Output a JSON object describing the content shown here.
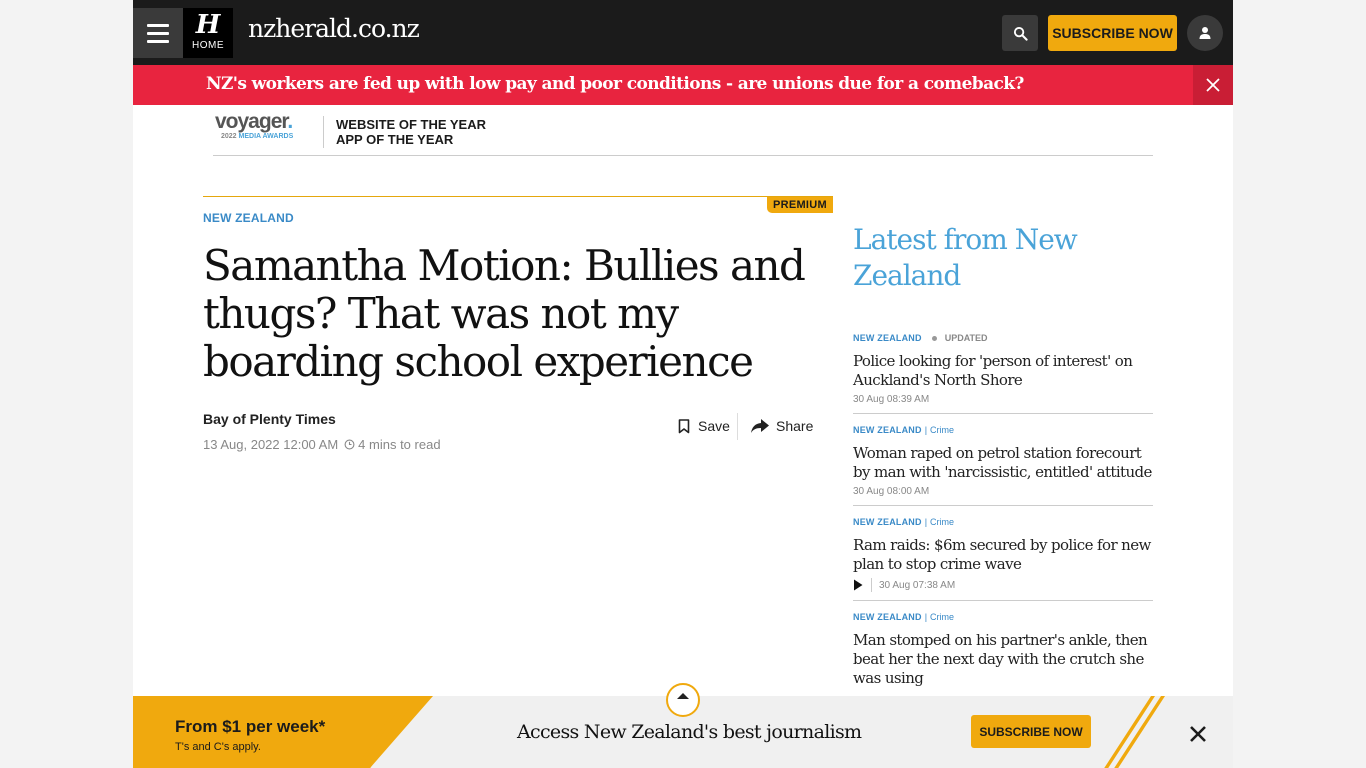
{
  "header": {
    "home_logo_letter": "H",
    "home_label": "HOME",
    "site_name": "nzherald.co.nz",
    "subscribe_label": "SUBSCRIBE NOW"
  },
  "breaking": {
    "text": "NZ's workers are fed up with low pay and poor conditions - are unions due for a comeback?"
  },
  "awards": {
    "brand": "voyager",
    "sub_year": "2022",
    "sub_label": "MEDIA AWARDS",
    "line1": "WEBSITE OF THE YEAR",
    "line2": "APP OF THE YEAR"
  },
  "article": {
    "badge": "PREMIUM",
    "section": "NEW ZEALAND",
    "headline": "Samantha Motion: Bullies and thugs? That was not my boarding school experience",
    "source": "Bay of Plenty Times",
    "date": "13 Aug, 2022 12:00 AM",
    "read_time": "4 mins to read",
    "save_label": "Save",
    "share_label": "Share"
  },
  "sidebar": {
    "title": "Latest from New Zealand",
    "items": [
      {
        "section": "NEW ZEALAND",
        "sub": "",
        "status": "UPDATED",
        "headline": "Police looking for 'person of interest' on Auckland's North Shore",
        "date": "30 Aug 08:39 AM",
        "video": false
      },
      {
        "section": "NEW ZEALAND",
        "sub": "Crime",
        "status": "",
        "headline": "Woman raped on petrol station forecourt by man with 'narcissistic, entitled' attitude",
        "date": "30 Aug 08:00 AM",
        "video": false
      },
      {
        "section": "NEW ZEALAND",
        "sub": "Crime",
        "status": "",
        "headline": "Ram raids: $6m secured by police for new plan to stop crime wave",
        "date": "30 Aug 07:38 AM",
        "video": true
      },
      {
        "section": "NEW ZEALAND",
        "sub": "Crime",
        "status": "",
        "headline": "Man stomped on his partner's ankle, then beat her the next day with the crutch she was using",
        "date": "",
        "video": false
      }
    ]
  },
  "bottom_bar": {
    "price": "From $1 per week*",
    "terms": "T's and C's apply.",
    "tagline": "Access New Zealand's best journalism",
    "subscribe_label": "SUBSCRIBE NOW"
  },
  "colors": {
    "brand_yellow": "#f0a90e",
    "breaking_red": "#e8243f",
    "link_blue": "#3a8ac7",
    "topbar": "#1b1b1b"
  }
}
